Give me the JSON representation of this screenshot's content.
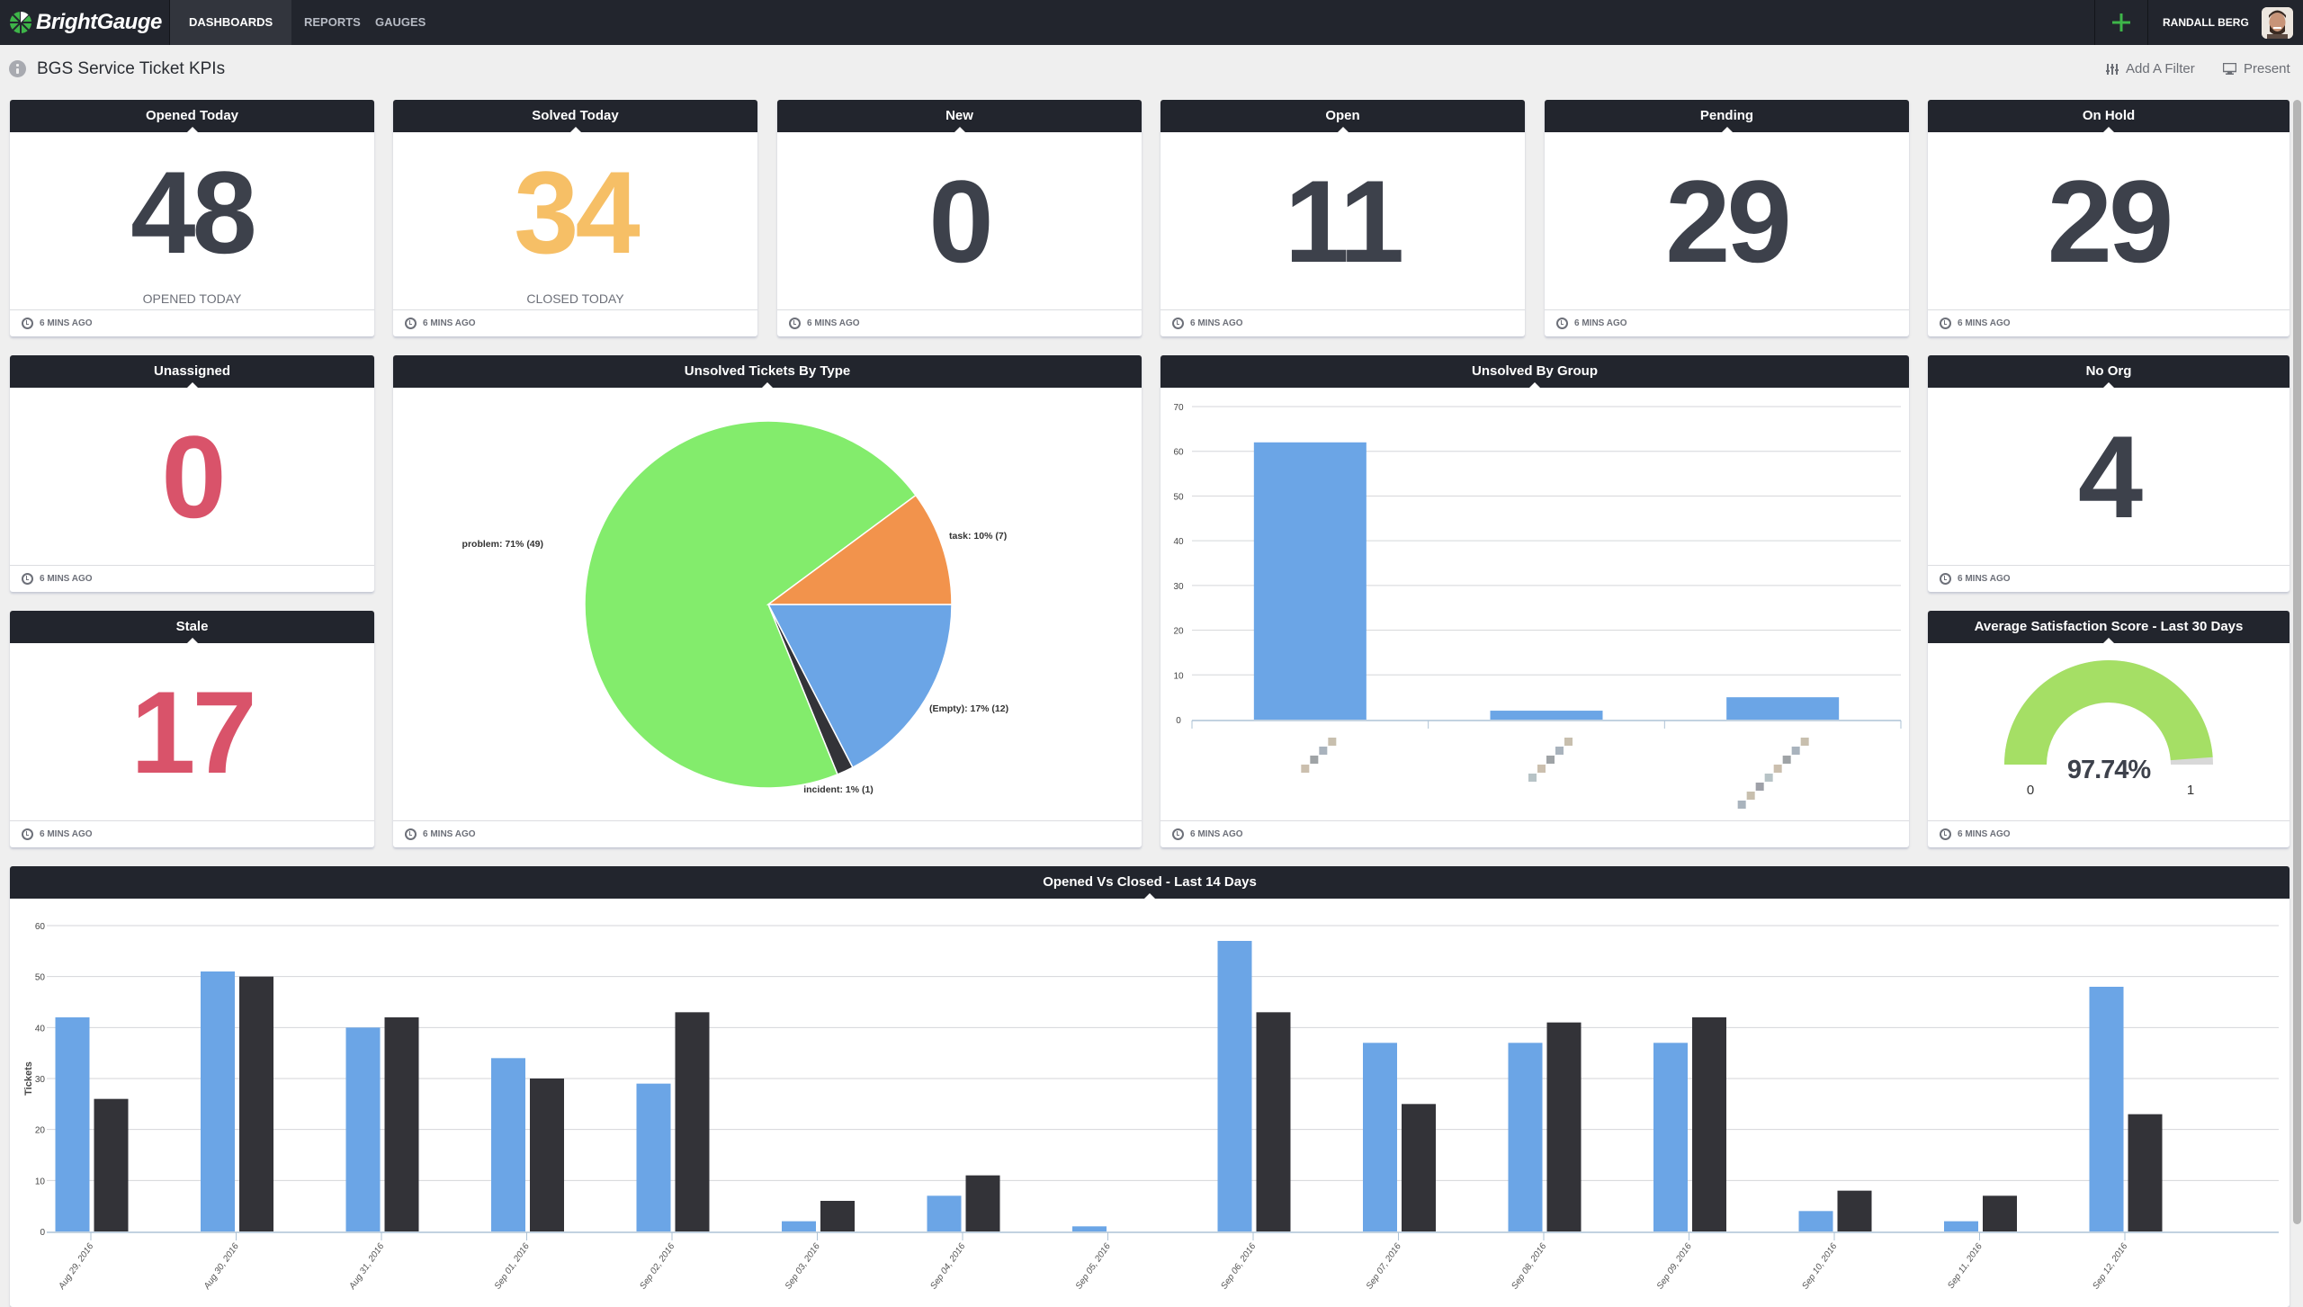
{
  "nav": {
    "brand": "BrightGauge",
    "items": [
      {
        "label": "DASHBOARDS",
        "active": true
      },
      {
        "label": "REPORTS",
        "active": false
      },
      {
        "label": "GAUGES",
        "active": false
      }
    ],
    "add_icon": "plus-icon",
    "user_name": "RANDALL BERG",
    "accent": "#3eb549"
  },
  "page": {
    "title": "BGS Service Ticket KPIs",
    "add_filter_label": "Add A Filter",
    "present_label": "Present"
  },
  "updated_label": "6 MINS AGO",
  "stats": [
    {
      "title": "Opened Today",
      "value": "48",
      "sub": "OPENED TODAY",
      "color": "#3d414b"
    },
    {
      "title": "Solved Today",
      "value": "34",
      "sub": "CLOSED TODAY",
      "color": "#f6bf66"
    },
    {
      "title": "New",
      "value": "0",
      "sub": "",
      "color": "#3d414b"
    },
    {
      "title": "Open",
      "value": "11",
      "sub": "",
      "color": "#3d414b"
    },
    {
      "title": "Pending",
      "value": "29",
      "sub": "",
      "color": "#3d414b"
    },
    {
      "title": "On Hold",
      "value": "29",
      "sub": "",
      "color": "#3d414b"
    },
    {
      "title": "Unassigned",
      "value": "0",
      "sub": "",
      "color": "#d9536a"
    },
    {
      "title": "No Org",
      "value": "4",
      "sub": "",
      "color": "#3d414b"
    },
    {
      "title": "Stale",
      "value": "17",
      "sub": "",
      "color": "#d9536a"
    }
  ],
  "gauge": {
    "title": "Average Satisfaction Score - Last 30 Days",
    "value_label": "97.74%",
    "fraction": 0.9774,
    "min_label": "0",
    "max_label": "1",
    "fill_color": "#a5df65",
    "track_color": "#d8d8d8"
  },
  "chart_data": [
    {
      "type": "pie",
      "title": "Unsolved Tickets By Type",
      "slices": [
        {
          "name": "(Empty)",
          "value": 12,
          "label": "(Empty): 17% (12)",
          "color": "#6ba5e6"
        },
        {
          "name": "incident",
          "value": 1,
          "label": "incident: 1% (1)",
          "color": "#333338"
        },
        {
          "name": "problem",
          "value": 49,
          "label": "problem: 71% (49)",
          "color": "#83ec6c"
        },
        {
          "name": "task",
          "value": 7,
          "label": "task: 10% (7)",
          "color": "#f2934c"
        }
      ]
    },
    {
      "type": "bar",
      "title": "Unsolved By Group",
      "categories": [
        "(obscured)",
        "(obscured)",
        "(obscured)"
      ],
      "values": [
        62,
        2,
        5
      ],
      "ylim": [
        0,
        70
      ],
      "yticks": [
        0,
        10,
        20,
        30,
        40,
        50,
        60,
        70
      ],
      "grid": true,
      "color": "#6ba5e6"
    },
    {
      "type": "bar",
      "title": "Opened Vs Closed - Last 14 Days",
      "xlabel": "",
      "ylabel": "Tickets",
      "ylim": [
        0,
        60
      ],
      "yticks": [
        0,
        10,
        20,
        30,
        40,
        50,
        60
      ],
      "grid": true,
      "categories": [
        "Aug 29, 2016",
        "Aug 30, 2016",
        "Aug 31, 2016",
        "Sep 01, 2016",
        "Sep 02, 2016",
        "Sep 03, 2016",
        "Sep 04, 2016",
        "Sep 05, 2016",
        "Sep 06, 2016",
        "Sep 07, 2016",
        "Sep 08, 2016",
        "Sep 09, 2016",
        "Sep 10, 2016",
        "Sep 11, 2016",
        "Sep 12, 2016"
      ],
      "series": [
        {
          "name": "Opened",
          "color": "#6ba5e6",
          "values": [
            42,
            51,
            40,
            34,
            29,
            2,
            7,
            1,
            57,
            37,
            37,
            37,
            4,
            2,
            48
          ]
        },
        {
          "name": "Closed",
          "color": "#333338",
          "values": [
            26,
            50,
            42,
            30,
            43,
            6,
            11,
            0,
            43,
            25,
            41,
            42,
            8,
            7,
            23
          ]
        }
      ]
    }
  ]
}
